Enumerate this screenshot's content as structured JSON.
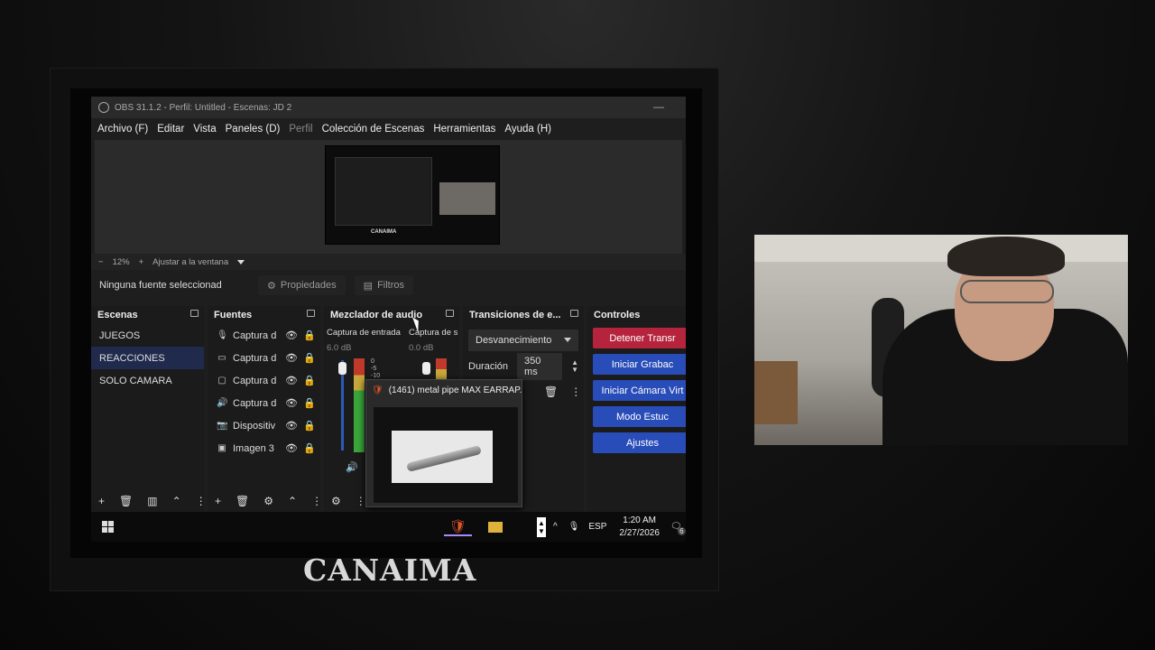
{
  "window": {
    "title": "OBS 31.1.2 - Perfil: Untitled - Escenas: JD 2",
    "minimize_glyph": "—"
  },
  "menu": {
    "items": [
      "Archivo (F)",
      "Editar",
      "Vista",
      "Paneles (D)",
      "Perfil",
      "Colección de Escenas",
      "Herramientas",
      "Ayuda (H)"
    ]
  },
  "preview": {
    "brand_label": "CANAIMA"
  },
  "zoom": {
    "minus": "−",
    "value": "12%",
    "plus": "+",
    "fit_label": "Ajustar a la ventana"
  },
  "props_bar": {
    "no_source": "Ninguna fuente seleccionad",
    "properties": "Propiedades",
    "filters": "Filtros"
  },
  "scenes": {
    "title": "Escenas",
    "items": [
      "JUEGOS",
      "REACCIONES",
      "SOLO CAMARA"
    ],
    "selected": "REACCIONES"
  },
  "sources": {
    "title": "Fuentes",
    "items": [
      {
        "icon": "microphone-icon",
        "name": "Captura d"
      },
      {
        "icon": "monitor-icon",
        "name": "Captura d"
      },
      {
        "icon": "window-icon",
        "name": "Captura d"
      },
      {
        "icon": "speaker-icon",
        "name": "Captura d"
      },
      {
        "icon": "camera-icon",
        "name": "Dispositiv"
      },
      {
        "icon": "image-icon",
        "name": "Imagen 3"
      }
    ]
  },
  "mixer": {
    "title": "Mezclador de audio",
    "channels": [
      {
        "name": "Captura de entrada",
        "db": "6.0 dB"
      },
      {
        "name": "Captura de s",
        "db": "0.0 dB"
      }
    ],
    "meter_ticks": [
      "0",
      "-5",
      "-10"
    ]
  },
  "transitions": {
    "title": "Transiciones de e...",
    "selected": "Desvanecimiento",
    "duration_label": "Duración",
    "duration_value": "350 ms"
  },
  "controls": {
    "title": "Controles",
    "buttons": [
      {
        "label": "Detener Transr",
        "color": "#b5243c"
      },
      {
        "label": "Iniciar Grabac",
        "color": "#284cb8"
      },
      {
        "label": "Iniciar Cámara Virt",
        "color": "#284cb8"
      },
      {
        "label": "Modo Estuc",
        "color": "#284cb8"
      },
      {
        "label": "Ajustes",
        "color": "#284cb8"
      }
    ]
  },
  "popup": {
    "title": "(1461) metal pipe MAX EARRAP..."
  },
  "taskbar": {
    "language": "ESP",
    "time": "1:20 AM",
    "date": "2/27/2026",
    "notification_count": "6"
  },
  "overlay": {
    "brand": "CANAIMA"
  }
}
